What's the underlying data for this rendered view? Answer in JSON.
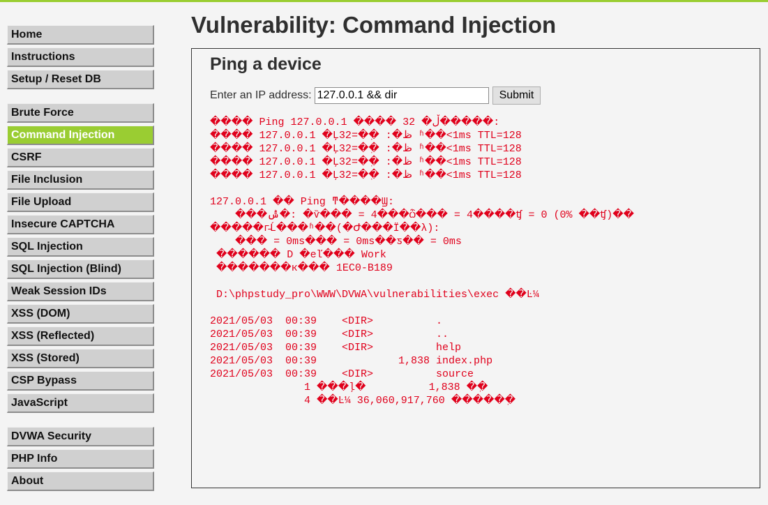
{
  "nav": {
    "group1": [
      "Home",
      "Instructions",
      "Setup / Reset DB"
    ],
    "group2": [
      "Brute Force",
      "Command Injection",
      "CSRF",
      "File Inclusion",
      "File Upload",
      "Insecure CAPTCHA",
      "SQL Injection",
      "SQL Injection (Blind)",
      "Weak Session IDs",
      "XSS (DOM)",
      "XSS (Reflected)",
      "XSS (Stored)",
      "CSP Bypass",
      "JavaScript"
    ],
    "group3": [
      "DVWA Security",
      "PHP Info",
      "About"
    ]
  },
  "page": {
    "title": "Vulnerability: Command Injection"
  },
  "box": {
    "title": "Ping a device",
    "ip_label": "Enter an IP address:",
    "ip_value": "127.0.0.1 && dir",
    "submit_label": "Submit"
  },
  "output_lines": [
    "���� Ping 127.0.0.1 ���� 32 �ֽڵ�����:",
    "���� 127.0.0.1 �Ļظ�: �ֽ�=32 ʱ��<1ms TTL=128",
    "���� 127.0.0.1 �Ļظ�: �ֽ�=32 ʱ��<1ms TTL=128",
    "���� 127.0.0.1 �Ļظ�: �ֽ�=32 ʱ��<1ms TTL=128",
    "���� 127.0.0.1 �Ļظ�: �ֽ�=32 ʱ��<1ms TTL=128",
    "",
    "127.0.0.1 �� Ping ͳ����Ϣ:",
    "    ���ݰ�: �ѷ��� = 4���ѽ��� = 4����ʧ = 0 (0% ��ʧ)��",
    "�����г̵Ĺ���ʱ��(�Ժ���Ϊ��λ):",
    "    ��� = 0ms��� = 0ms��ƽ�� = 0ms",
    " ������ D �еľ��� Work",
    " �������к��� 1EC0-B189",
    "",
    " D:\\phpstudy_pro\\WWW\\DVWA\\vulnerabilities\\exec ��Ŀ¼",
    "",
    "2021/05/03  00:39    <DIR>          .",
    "2021/05/03  00:39    <DIR>          ..",
    "2021/05/03  00:39    <DIR>          help",
    "2021/05/03  00:39             1,838 index.php",
    "2021/05/03  00:39    <DIR>          source",
    "               1 ���ļ�          1,838 �ֽ�",
    "               4 ��Ŀ¼ 36,060,917,760 �����ֽ�"
  ]
}
